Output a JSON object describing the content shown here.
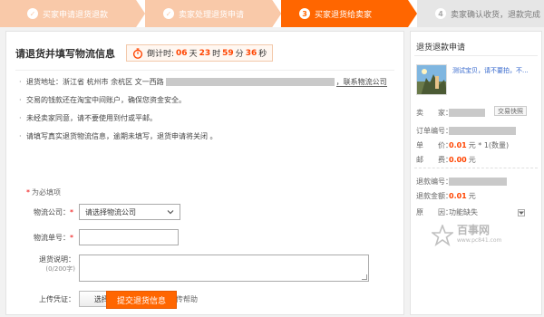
{
  "progress": {
    "steps": [
      {
        "badge": "✓",
        "label": "买家申请退货退款",
        "state": "done"
      },
      {
        "badge": "✓",
        "label": "卖家处理退货申请",
        "state": "done"
      },
      {
        "badge": "3",
        "label": "买家退货给卖家",
        "state": "current"
      },
      {
        "badge": "4",
        "label": "卖家确认收货，退款完成",
        "state": "todo"
      }
    ]
  },
  "main": {
    "title": "请退货并填写物流信息",
    "timer": {
      "prefix": "倒计时:",
      "days": "06",
      "days_unit": "天",
      "hours": "23",
      "hours_unit": "时",
      "minutes": "59",
      "minutes_unit": "分",
      "seconds": "36",
      "seconds_unit": "秒"
    },
    "notice": {
      "address_prefix": "退货地址：浙江省 杭州市 余杭区 文一西路",
      "address_suffix": "，联系物流公司",
      "line2": "交易的钱款还在淘宝中间账户，确保您资金安全。",
      "line3": "未经卖家同意，请不要使用到付或平邮。",
      "line4": "请填写真实退货物流信息，逾期未填写，退货申请将关闭 。"
    },
    "required_note": "为必填项",
    "form": {
      "company_label": "物流公司：",
      "company_value": "请选择物流公司",
      "tracking_label": "物流单号：",
      "desc_label": "退货说明：",
      "desc_counter": "(0/200字)",
      "upload_label": "上传凭证：",
      "upload_button": "选择凭证图片",
      "upload_help": "上传帮助"
    },
    "submit_label": "提交退货信息"
  },
  "side": {
    "title": "退货退款申请",
    "product_name": "测试宝贝，请不要拍，不...",
    "seller_label": "卖　　家：",
    "snapshot_label": "交易快照",
    "order_label": "订单编号：",
    "unit_price_label": "单　　价：",
    "unit_price": "0.01",
    "unit_price_suffix": "元 * 1(数量)",
    "shipping_label": "邮　　费：",
    "shipping": "0.00",
    "shipping_unit": "元",
    "refund_no_label": "退款编号：",
    "refund_amount_label": "退款金额：",
    "refund_amount": "0.01",
    "refund_unit": "元",
    "reason_label": "原　　因：",
    "reason_value": "功能缺失"
  },
  "watermark": {
    "name": "百事网",
    "url": "www.pc841.com"
  },
  "colors": {
    "accent": "#ff6600",
    "done_step": "#f9c9a9",
    "todo_step": "#e6e6e6",
    "price_red": "#ff4400",
    "link_blue": "#3366cc"
  }
}
